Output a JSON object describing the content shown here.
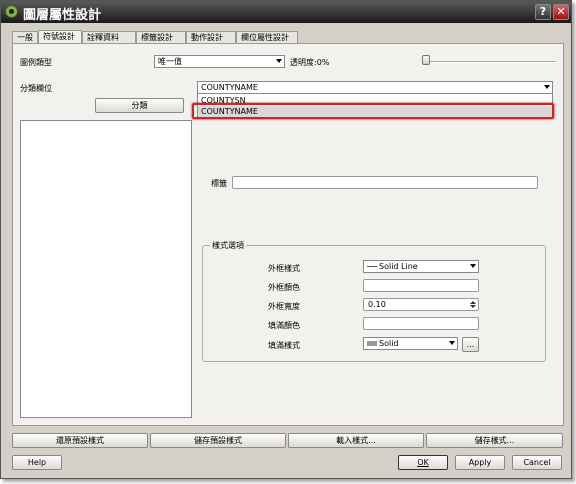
{
  "window": {
    "title": "圖層屬性設計",
    "help_glyph": "?",
    "close_glyph": "✕"
  },
  "tabs": [
    {
      "label": "一般"
    },
    {
      "label": "符號設計"
    },
    {
      "label": "詮釋資料"
    },
    {
      "label": "標籤設計"
    },
    {
      "label": "動作設計"
    },
    {
      "label": "欄位屬性設計"
    }
  ],
  "symbology": {
    "legend_type_label": "圖例類型",
    "legend_type_value": "唯一值",
    "transparency_label": "透明度:0%",
    "transparency_value": 0,
    "classification_field_label": "分類欄位",
    "classification_field_value": "COUNTYNAME",
    "classify_button": "分類",
    "dropdown_options": [
      "COUNTYSN",
      "COUNTYNAME"
    ],
    "label_label": "標籤",
    "style_options_title": "樣式選項",
    "outline_style_label": "外框樣式",
    "outline_style_value": "Solid Line",
    "outline_color_label": "外框顏色",
    "outline_width_label": "外框寬度",
    "outline_width_value": "0.10",
    "fill_color_label": "填滿顏色",
    "fill_style_label": "填滿樣式",
    "fill_style_value": "Solid",
    "browse_button": "..."
  },
  "bottom_buttons": {
    "restore_default": "還原預設樣式",
    "save_default": "儲存預設樣式",
    "load_style": "載入樣式...",
    "save_style": "儲存樣式..."
  },
  "dialog_buttons": {
    "help": "Help",
    "ok": "OK",
    "apply": "Apply",
    "cancel": "Cancel"
  },
  "colors": {
    "highlight_box": "#d3202a",
    "qgis_icon": "#7fb542"
  }
}
